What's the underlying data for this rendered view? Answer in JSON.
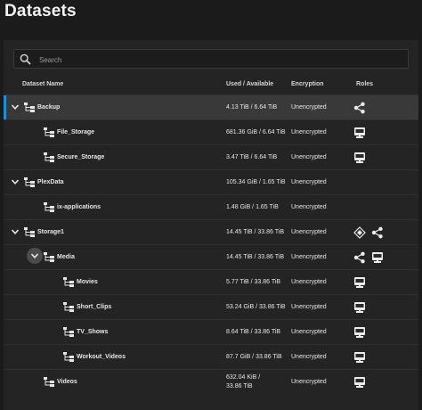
{
  "page": {
    "title": "Datasets"
  },
  "search": {
    "placeholder": "Search"
  },
  "table": {
    "headers": {
      "name": "Dataset Name",
      "used": "Used / Available",
      "encryption": "Encryption",
      "roles": "Roles"
    },
    "rows": [
      {
        "name": "Backup",
        "used": "4.13 TiB / 6.64 TiB",
        "enc": "Unencrypted"
      },
      {
        "name": "File_Storage",
        "used": "681.36 GiB / 6.64 TiB",
        "enc": "Unencrypted"
      },
      {
        "name": "Secure_Storage",
        "used": "3.47 TiB / 6.64 TiB",
        "enc": "Unencrypted"
      },
      {
        "name": "PlexData",
        "used": "105.34 GiB / 1.65 TiB",
        "enc": "Unencrypted"
      },
      {
        "name": "ix-applications",
        "used": "1.48 GiB / 1.65 TiB",
        "enc": "Unencrypted"
      },
      {
        "name": "Storage1",
        "used": "14.45 TiB / 33.86 TiB",
        "enc": "Unencrypted"
      },
      {
        "name": "Media",
        "used": "14.45 TiB / 33.86 TiB",
        "enc": "Unencrypted"
      },
      {
        "name": "Movies",
        "used": "5.77 TiB / 33.86 TiB",
        "enc": "Unencrypted"
      },
      {
        "name": "Short_Clips",
        "used": "53.24 GiB / 33.86 TiB",
        "enc": "Unencrypted"
      },
      {
        "name": "TV_Shows",
        "used": "8.64 TiB / 33.86 TiB",
        "enc": "Unencrypted"
      },
      {
        "name": "Workout_Videos",
        "used": "87.7 GiB / 33.86 TiB",
        "enc": "Unencrypted"
      },
      {
        "name": "Videos",
        "used_line1": "632.04 KiB /",
        "used_line2": "33.86 TiB",
        "enc": "Unencrypted"
      }
    ]
  },
  "icons": {
    "share": "share-icon",
    "smb": "smb-share-icon",
    "apps": "apps-icon",
    "expand": "chevron-down-icon",
    "tree": "dataset-tree-icon",
    "search": "search-icon"
  },
  "colors": {
    "accent": "#1f8ed6",
    "background": "#1b1b1b",
    "card": "#242424",
    "selected": "#393939"
  }
}
